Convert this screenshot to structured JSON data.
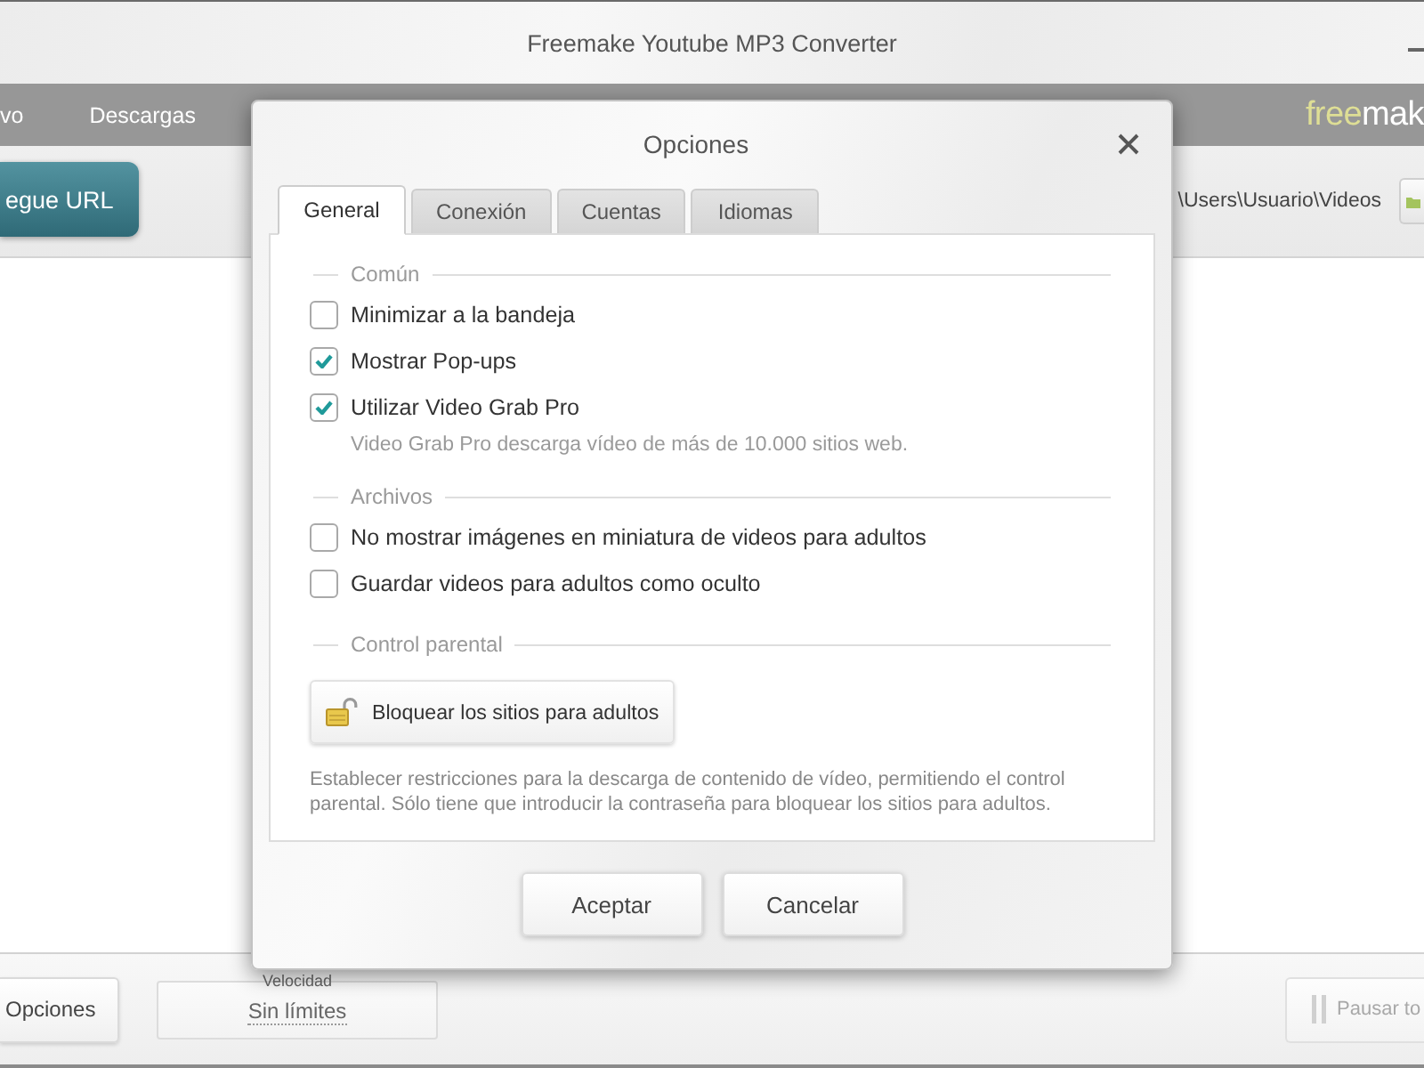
{
  "window": {
    "title": "Freemake Youtube MP3 Converter"
  },
  "menu_bar": {
    "items": [
      {
        "label": "vo"
      },
      {
        "label": "Descargas"
      }
    ],
    "logo": {
      "accent": "free",
      "rest": "mak"
    }
  },
  "toolbar": {
    "paste_url_button": "egue URL",
    "output_path": "\\Users\\Usuario\\Videos"
  },
  "bottom_bar": {
    "options_button": "Opciones",
    "speed": {
      "label": "Velocidad",
      "value": "Sin límites"
    },
    "pause_button": {
      "label": "Pausar to",
      "disabled": true
    }
  },
  "dialog": {
    "title": "Opciones",
    "tabs": [
      {
        "label": "General",
        "selected": true
      },
      {
        "label": "Conexión",
        "selected": false
      },
      {
        "label": "Cuentas",
        "selected": false
      },
      {
        "label": "Idiomas",
        "selected": false
      }
    ],
    "sections": [
      {
        "title": "Común",
        "items": [
          {
            "kind": "checkbox",
            "label": "Minimizar a la bandeja",
            "checked": false
          },
          {
            "kind": "checkbox",
            "label": "Mostrar Pop-ups",
            "checked": true
          },
          {
            "kind": "checkbox",
            "label": "Utilizar Video Grab Pro",
            "checked": true
          },
          {
            "kind": "hint",
            "text": "Video Grab Pro descarga vídeo de más de 10.000 sitios web."
          }
        ]
      },
      {
        "title": "Archivos",
        "items": [
          {
            "kind": "checkbox",
            "label": "No mostrar imágenes en miniatura de videos para adultos",
            "checked": false
          },
          {
            "kind": "checkbox",
            "label": "Guardar videos para adultos como oculto",
            "checked": false
          }
        ]
      },
      {
        "title": "Control parental",
        "items": [
          {
            "kind": "button",
            "label": "Bloquear los sitios para adultos"
          },
          {
            "kind": "note",
            "text": "Establecer restricciones para la descarga de contenido de vídeo, permitiendo el control parental. Sólo tiene que introducir la contraseña para bloquear los sitios para adultos."
          }
        ]
      }
    ],
    "buttons": [
      "Aceptar",
      "Cancelar"
    ]
  }
}
